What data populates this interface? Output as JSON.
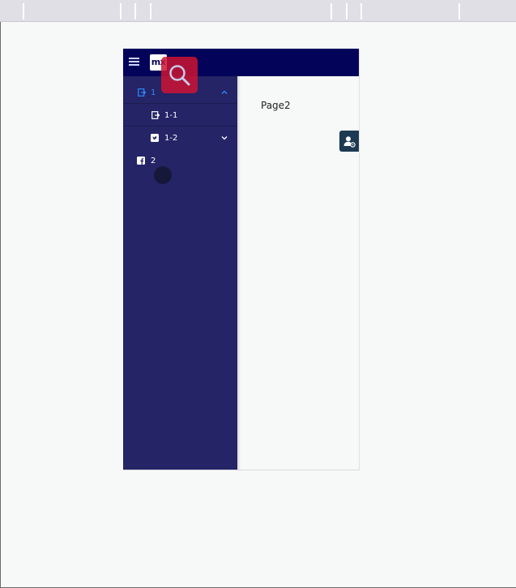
{
  "header": {
    "logo_text": "mx",
    "menu_icon": "hamburger-icon",
    "search_icon": "search-icon",
    "colors": {
      "header_bg": "#030359",
      "sidebar_bg": "#252466",
      "active_item": "#2d8cff",
      "search_overlay": "#cd1432"
    }
  },
  "sidebar": {
    "items": [
      {
        "label": "1",
        "icon": "sign-in-icon",
        "expanded": true,
        "active": true
      },
      {
        "label": "1-1",
        "icon": "sign-in-icon"
      },
      {
        "label": "1-2",
        "icon": "twitter-icon",
        "expanded": false
      },
      {
        "label": "2",
        "icon": "facebook-icon"
      }
    ]
  },
  "main": {
    "page_title": "Page2",
    "user_badge_icon": "user-settings-icon"
  }
}
